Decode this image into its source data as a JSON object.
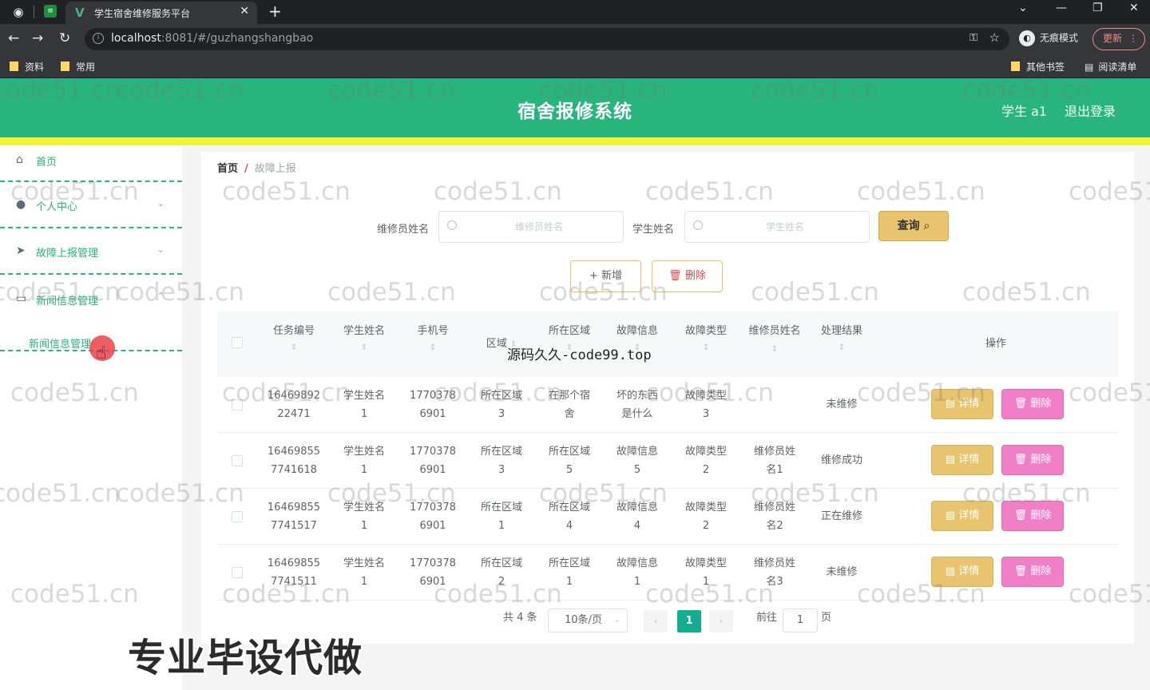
{
  "browser": {
    "tab_title": "学生宿舍维修服务平台",
    "tab_close": "✕",
    "new_tab": "+",
    "url_host": "localhost",
    "url_rest": ":8081/#/guzhangshangbao",
    "incognito_label": "无痕模式",
    "update_label": "更新",
    "bookmarks_left": [
      "资料",
      "常用"
    ],
    "bookmarks_right": [
      "其他书签",
      "阅读清单"
    ]
  },
  "header": {
    "title": "宿舍报修系统",
    "user": "学生 a1",
    "logout": "退出登录"
  },
  "sidebar": {
    "items": [
      {
        "label": "首页",
        "icon": "home-icon"
      },
      {
        "label": "个人中心",
        "icon": "user-icon"
      },
      {
        "label": "故障上报管理",
        "icon": "send-icon"
      },
      {
        "label": "新闻信息管理",
        "icon": "news-icon"
      }
    ],
    "subitem": "新闻信息管理"
  },
  "breadcrumb": {
    "home": "首页",
    "sep": "/",
    "current": "故障上报"
  },
  "search": {
    "repairer_label": "维修员姓名",
    "repairer_placeholder": "维修员姓名",
    "student_label": "学生姓名",
    "student_placeholder": "学生姓名",
    "query_label": "查询"
  },
  "toolbar": {
    "add_label": "+ 新增",
    "delete_label": "删除"
  },
  "table": {
    "headers": [
      "任务编号",
      "学生姓名",
      "手机号",
      "区域",
      "所在区域",
      "故障信息",
      "故障类型",
      "维修员姓名",
      "处理结果",
      "操作"
    ],
    "detail_label": "详情",
    "delete_label": "删除",
    "rows": [
      {
        "task": [
          "16469892",
          "22471"
        ],
        "student": [
          "学生姓名",
          "1"
        ],
        "phone": [
          "1770378",
          "6901"
        ],
        "area": [
          "所在区域",
          "3"
        ],
        "location": [
          "在那个宿",
          "舍"
        ],
        "fault": [
          "坏的东西",
          "是什么"
        ],
        "type": [
          "故障类型",
          "3"
        ],
        "repairer": [
          "",
          ""
        ],
        "result": "未维修"
      },
      {
        "task": [
          "16469855",
          "7741618"
        ],
        "student": [
          "学生姓名",
          "1"
        ],
        "phone": [
          "1770378",
          "6901"
        ],
        "area": [
          "所在区域",
          "3"
        ],
        "location": [
          "所在区域",
          "5"
        ],
        "fault": [
          "故障信息",
          "5"
        ],
        "type": [
          "故障类型",
          "2"
        ],
        "repairer": [
          "维修员姓",
          "名1"
        ],
        "result": "维修成功"
      },
      {
        "task": [
          "16469855",
          "7741517"
        ],
        "student": [
          "学生姓名",
          "1"
        ],
        "phone": [
          "1770378",
          "6901"
        ],
        "area": [
          "所在区域",
          "1"
        ],
        "location": [
          "所在区域",
          "4"
        ],
        "fault": [
          "故障信息",
          "4"
        ],
        "type": [
          "故障类型",
          "2"
        ],
        "repairer": [
          "维修员姓",
          "名2"
        ],
        "result": "正在维修"
      },
      {
        "task": [
          "16469855",
          "7741511"
        ],
        "student": [
          "学生姓名",
          "1"
        ],
        "phone": [
          "1770378",
          "6901"
        ],
        "area": [
          "所在区域",
          "2"
        ],
        "location": [
          "所在区域",
          "1"
        ],
        "fault": [
          "故障信息",
          "1"
        ],
        "type": [
          "故障类型",
          "1"
        ],
        "repairer": [
          "维修员姓",
          "名3"
        ],
        "result": "未维修"
      }
    ]
  },
  "pagination": {
    "total": "共 4 条",
    "page_size": "10条/页",
    "current_page": "1",
    "goto_label": "前往",
    "goto_value": "1",
    "page_unit": "页"
  },
  "overlays": {
    "watermark": "code51.cn",
    "site_caption": "源码久久-code99.top",
    "promo": "专业毕设代做"
  },
  "colors": {
    "header_green": "#27b47d",
    "strip_yellow": "#f1f23a",
    "detail_btn": "#e8c46e",
    "delete_btn": "#f07fc8",
    "page_active": "#13ae8f"
  }
}
